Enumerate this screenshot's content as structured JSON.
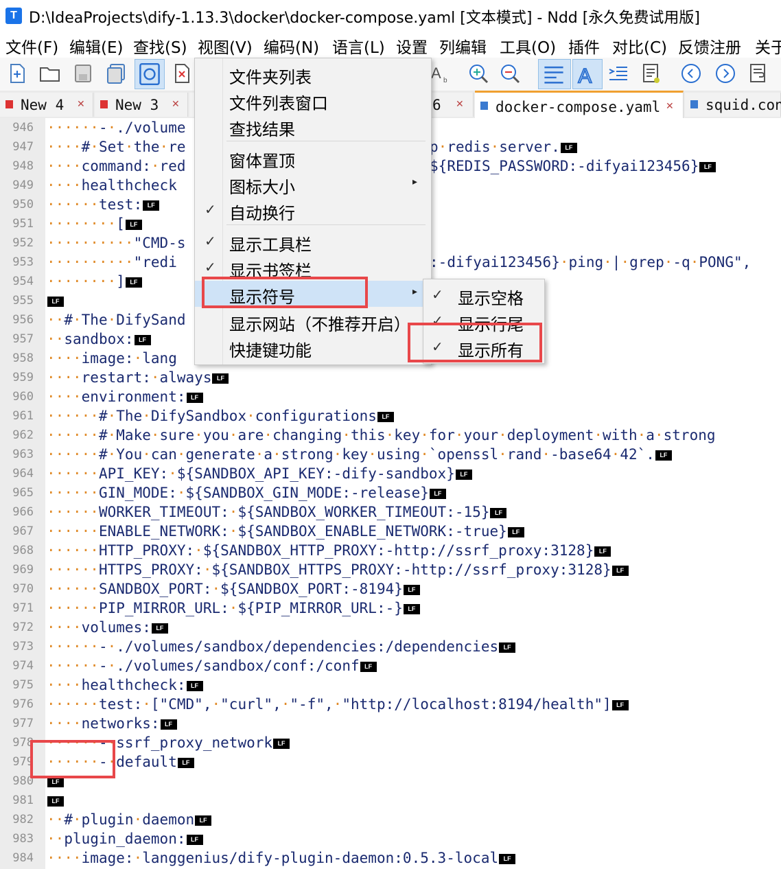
{
  "window": {
    "title": "D:\\IdeaProjects\\dify-1.13.3\\docker\\docker-compose.yaml [文本模式] - Ndd [永久免费试用版]",
    "app_icon": "T"
  },
  "menubar": [
    "文件(F)",
    "编辑(E)",
    "查找(S)",
    "视图(V)",
    "编码(N)",
    "语言(L)",
    "设置",
    "列编辑",
    "工具(O)",
    "插件",
    "对比(C)",
    "反馈注册",
    "关于"
  ],
  "tabs": [
    {
      "label": "New 4",
      "close": "✕"
    },
    {
      "label": "New 3",
      "close": "✕"
    },
    {
      "label": "6",
      "close": "✕"
    },
    {
      "label": "docker-compose.yaml",
      "close": "✕"
    },
    {
      "label": "squid.conf",
      "close": ""
    }
  ],
  "view_menu": {
    "items": [
      {
        "label": "文件夹列表",
        "checked": "",
        "arrow": ""
      },
      {
        "label": "文件列表窗口",
        "checked": "",
        "arrow": ""
      },
      {
        "label": "查找结果",
        "checked": "",
        "arrow": ""
      },
      {
        "label": "窗体置顶",
        "checked": "",
        "arrow": ""
      },
      {
        "label": "图标大小",
        "checked": "",
        "arrow": "▸"
      },
      {
        "label": "自动换行",
        "checked": "✓",
        "arrow": ""
      },
      {
        "label": "显示工具栏",
        "checked": "✓",
        "arrow": ""
      },
      {
        "label": "显示书签栏",
        "checked": "✓",
        "arrow": ""
      },
      {
        "label": "显示符号",
        "checked": "",
        "arrow": "▸"
      },
      {
        "label": "显示网站（不推荐开启）",
        "checked": "",
        "arrow": ""
      },
      {
        "label": "快捷键功能",
        "checked": "",
        "arrow": ""
      }
    ]
  },
  "symbol_submenu": {
    "items": [
      {
        "label": "显示空格",
        "checked": "✓"
      },
      {
        "label": "显示行尾",
        "checked": "✓"
      },
      {
        "label": "显示所有",
        "checked": "✓"
      }
    ]
  },
  "lf_glyph": "LF",
  "space_glyph": "·",
  "editor": {
    "lines": [
      {
        "n": "946",
        "t": "      - ./volume",
        "lf": false
      },
      {
        "n": "947",
        "t": "    # Set the re",
        "lf": false,
        "r": "p redis server.",
        "rlf": true
      },
      {
        "n": "948",
        "t": "    command: red",
        "lf": false,
        "r": "${REDIS_PASSWORD:-difyai123456}",
        "rlf": true
      },
      {
        "n": "949",
        "t": "    healthcheck",
        "lf": false
      },
      {
        "n": "950",
        "t": "      test:",
        "lf": true
      },
      {
        "n": "951",
        "t": "        [",
        "lf": true
      },
      {
        "n": "952",
        "t": "          \"CMD-s",
        "lf": false
      },
      {
        "n": "953",
        "t": "          \"redi",
        "lf": false,
        "r": ":-difyai123456} ping | grep -q PONG\",",
        "rlf": false
      },
      {
        "n": "954",
        "t": "        ]",
        "lf": true
      },
      {
        "n": "955",
        "t": "",
        "lf": true
      },
      {
        "n": "956",
        "t": "  # The DifySand",
        "lf": false
      },
      {
        "n": "957",
        "t": "  sandbox:",
        "lf": true
      },
      {
        "n": "958",
        "t": "    image: lang",
        "lf": false
      },
      {
        "n": "959",
        "t": "    restart: always",
        "lf": true
      },
      {
        "n": "960",
        "t": "    environment:",
        "lf": true
      },
      {
        "n": "961",
        "t": "      # The DifySandbox configurations",
        "lf": true
      },
      {
        "n": "962",
        "t": "      # Make sure you are changing this key for your deployment with a strong",
        "lf": false
      },
      {
        "n": "963",
        "t": "      # You can generate a strong key using `openssl rand -base64 42`.",
        "lf": true
      },
      {
        "n": "964",
        "t": "      API_KEY: ${SANDBOX_API_KEY:-dify-sandbox}",
        "lf": true
      },
      {
        "n": "965",
        "t": "      GIN_MODE: ${SANDBOX_GIN_MODE:-release}",
        "lf": true
      },
      {
        "n": "966",
        "t": "      WORKER_TIMEOUT: ${SANDBOX_WORKER_TIMEOUT:-15}",
        "lf": true
      },
      {
        "n": "967",
        "t": "      ENABLE_NETWORK: ${SANDBOX_ENABLE_NETWORK:-true}",
        "lf": true
      },
      {
        "n": "968",
        "t": "      HTTP_PROXY: ${SANDBOX_HTTP_PROXY:-http://ssrf_proxy:3128}",
        "lf": true
      },
      {
        "n": "969",
        "t": "      HTTPS_PROXY: ${SANDBOX_HTTPS_PROXY:-http://ssrf_proxy:3128}",
        "lf": true
      },
      {
        "n": "970",
        "t": "      SANDBOX_PORT: ${SANDBOX_PORT:-8194}",
        "lf": true
      },
      {
        "n": "971",
        "t": "      PIP_MIRROR_URL: ${PIP_MIRROR_URL:-}",
        "lf": true
      },
      {
        "n": "972",
        "t": "    volumes:",
        "lf": true
      },
      {
        "n": "973",
        "t": "      - ./volumes/sandbox/dependencies:/dependencies",
        "lf": true
      },
      {
        "n": "974",
        "t": "      - ./volumes/sandbox/conf:/conf",
        "lf": true
      },
      {
        "n": "975",
        "t": "    healthcheck:",
        "lf": true
      },
      {
        "n": "976",
        "t": "      test: [\"CMD\", \"curl\", \"-f\", \"http://localhost:8194/health\"]",
        "lf": true
      },
      {
        "n": "977",
        "t": "    networks:",
        "lf": true
      },
      {
        "n": "978",
        "t": "      - ssrf_proxy_network",
        "lf": true
      },
      {
        "n": "979",
        "t": "      - default",
        "lf": true
      },
      {
        "n": "980",
        "t": "",
        "lf": true
      },
      {
        "n": "981",
        "t": "",
        "lf": true
      },
      {
        "n": "982",
        "t": "  # plugin daemon",
        "lf": true
      },
      {
        "n": "983",
        "t": "  plugin_daemon:",
        "lf": true
      },
      {
        "n": "984",
        "t": "    image: langgenius/dify-plugin-daemon:0.5.3-local",
        "lf": true
      }
    ]
  },
  "colors": {
    "highlight_box": "#e8474a",
    "space_dot": "#e08a28",
    "code_text": "#1a2a70"
  }
}
